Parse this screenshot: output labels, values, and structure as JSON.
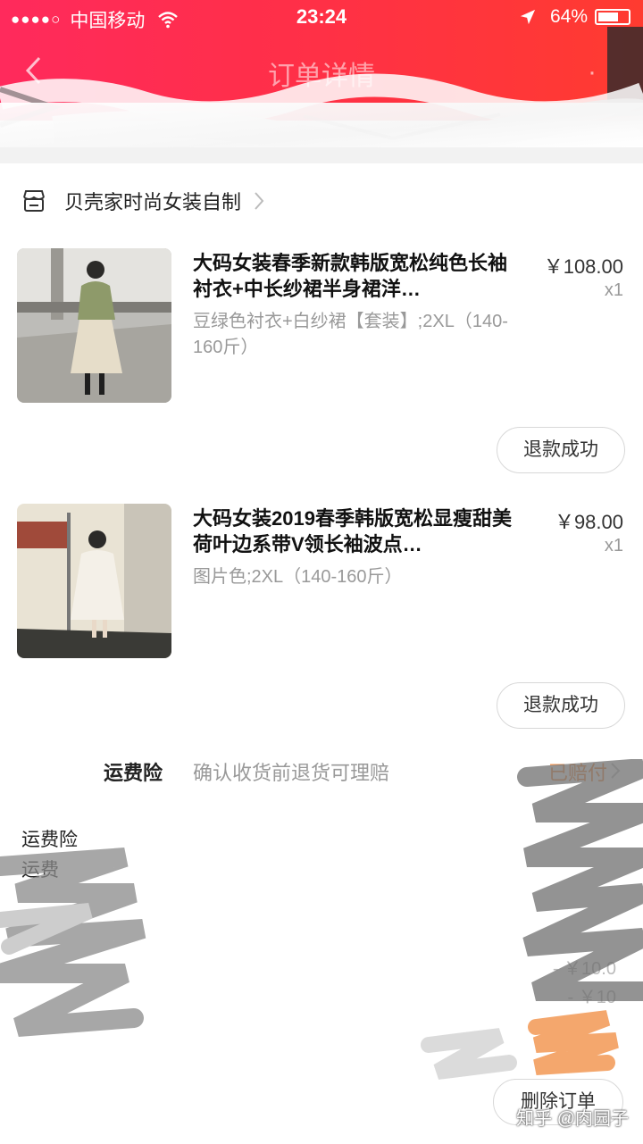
{
  "status_bar": {
    "signal": "●●●●○",
    "carrier": "中国移动",
    "time": "23:24",
    "battery": "64%"
  },
  "nav": {
    "title": "订单详情",
    "more": "·"
  },
  "shop": {
    "name": "贝壳家时尚女装自制"
  },
  "items": [
    {
      "name": "大码女装春季新款韩版宽松纯色长袖衬衣+中长纱裙半身裙洋…",
      "spec": "豆绿色衬衣+白纱裙【套装】;2XL（140-160斤）",
      "price": "￥108.00",
      "qty": "x1",
      "status": "退款成功"
    },
    {
      "name": "大码女装2019春季韩版宽松显瘦甜美荷叶边系带V领长袖波点…",
      "spec": "图片色;2XL（140-160斤）",
      "price": "￥98.00",
      "qty": "x1",
      "status": "退款成功"
    }
  ],
  "insurance": {
    "label": "运费险",
    "desc": "确认收货前退货可理赔",
    "status": "已赔付"
  },
  "summary": {
    "line1": "运费险",
    "line2": "运费",
    "faded_price_1": "- ￥10.0",
    "faded_price_2": "- ￥10"
  },
  "actions": {
    "delete": "删除订单"
  },
  "watermark": "知乎 @肉园子",
  "colors": {
    "header_start": "#ff2a5c",
    "header_end": "#ff3b30",
    "accent_orange": "#f27b27"
  },
  "icons": {
    "back": "chevron-left-icon",
    "shop": "store-icon",
    "wifi": "wifi-icon",
    "location": "location-arrow-icon",
    "battery": "battery-icon"
  }
}
